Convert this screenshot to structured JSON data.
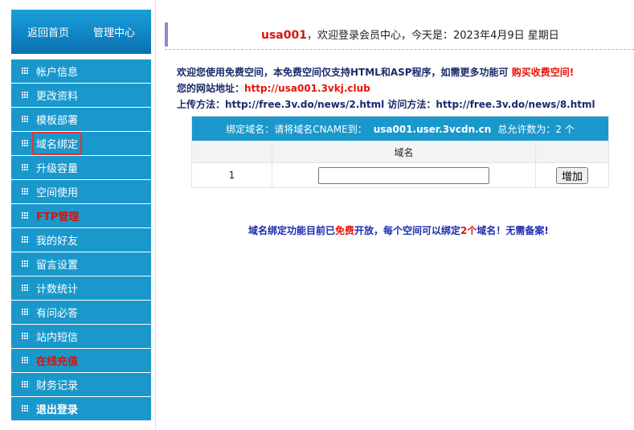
{
  "sidebar": {
    "home_label": "返回首页",
    "admin_label": "管理中心",
    "items": [
      {
        "label": "帐户信息",
        "style": ""
      },
      {
        "label": "更改资料",
        "style": ""
      },
      {
        "label": "模板部署",
        "style": ""
      },
      {
        "label": "域名绑定",
        "style": "selected"
      },
      {
        "label": "升级容量",
        "style": ""
      },
      {
        "label": "空间使用",
        "style": ""
      },
      {
        "label": "FTP管理",
        "style": "red"
      },
      {
        "label": "我的好友",
        "style": ""
      },
      {
        "label": "留言设置",
        "style": ""
      },
      {
        "label": "计数统计",
        "style": ""
      },
      {
        "label": "有问必答",
        "style": ""
      },
      {
        "label": "站内短信",
        "style": ""
      },
      {
        "label": "在线充值",
        "style": "red"
      },
      {
        "label": "财务记录",
        "style": ""
      },
      {
        "label": "退出登录",
        "style": "bold"
      }
    ]
  },
  "header": {
    "username": "usa001",
    "greeting": "，欢迎登录会员中心，今天是：2023年4月9日 星期日"
  },
  "info": {
    "line1_text": "欢迎您使用免费空间，本免费空间仅支持HTML和ASP程序，如需更多功能可 ",
    "line1_link": "购买收费空间",
    "line1_end": "!",
    "site_label": "您的网站地址：",
    "site_url": "http://usa001.3vkj.club",
    "upload_label": "上传方法：",
    "upload_url": "http://free.3v.do/news/2.html",
    "access_label": " 访问方法：",
    "access_url": "http://free.3v.do/news/8.html"
  },
  "bind_table": {
    "header_prefix": "绑定域名：请将域名CNAME到：",
    "cname": "usa001.user.3vcdn.cn",
    "limit_text": "总允许数为：2 个",
    "col_domain": "域名",
    "row_index": "1",
    "input_value": "",
    "add_button": "增加"
  },
  "notice": {
    "part1": "域名绑定功能目前已",
    "part2": "免费",
    "part3": "开放，每个空间可以绑定",
    "part4": "2个",
    "part5": "域名！无需备案!"
  }
}
